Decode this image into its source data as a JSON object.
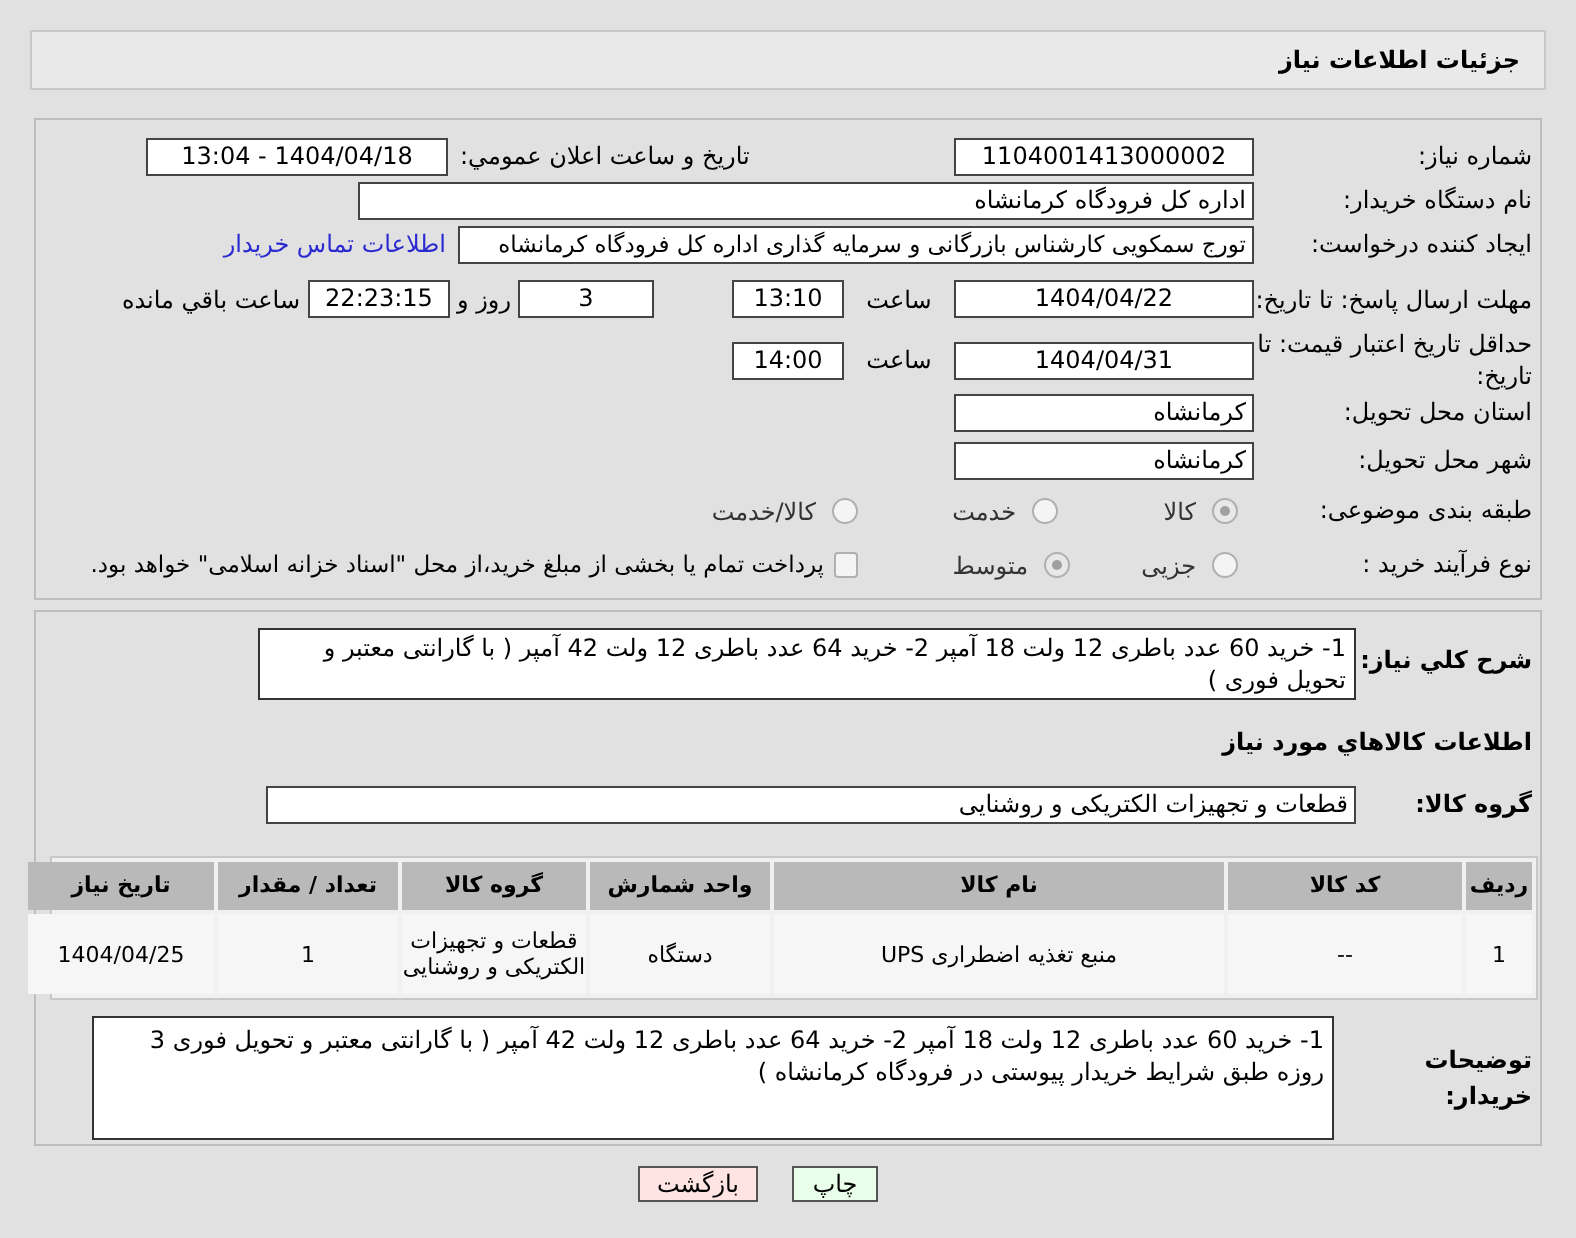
{
  "header": {
    "title": "جزئیات اطلاعات نیاز"
  },
  "need_number": {
    "label": "شماره نیاز:",
    "value": "1104001413000002"
  },
  "announce": {
    "label": "تاریخ و ساعت اعلان عمومي:",
    "value": "1404/04/18 - 13:04"
  },
  "buyer_org": {
    "label": "نام دستگاه خریدار:",
    "value": "اداره کل فرودگاه کرمانشاه"
  },
  "requester": {
    "label": "ایجاد کننده درخواست:",
    "value": "تورج سمکویی کارشناس بازرگانی و سرمایه گذاری اداره کل فرودگاه کرمانشاه",
    "link": "اطلاعات تماس خریدار"
  },
  "response_deadline": {
    "label": "مهلت ارسال پاسخ: تا تاریخ:",
    "date": "1404/04/22",
    "time_label": "ساعت",
    "time": "13:10",
    "days": "3",
    "days_label": "روز و",
    "remaining": "22:23:15",
    "remaining_label": "ساعت باقي مانده"
  },
  "price_validity": {
    "label": "حداقل تاریخ اعتبار قیمت: تا تاریخ:",
    "date": "1404/04/31",
    "time_label": "ساعت",
    "time": "14:00"
  },
  "province": {
    "label": "استان محل تحویل:",
    "value": "کرمانشاه"
  },
  "city": {
    "label": "شهر محل تحویل:",
    "value": "کرمانشاه"
  },
  "category": {
    "label": "طبقه بندی موضوعی:",
    "options": [
      {
        "label": "کالا",
        "selected": true
      },
      {
        "label": "خدمت",
        "selected": false
      },
      {
        "label": "کالا/خدمت",
        "selected": false
      }
    ]
  },
  "process": {
    "label": "نوع فرآیند خرید :",
    "options": [
      {
        "label": "جزیی",
        "selected": false
      },
      {
        "label": "متوسط",
        "selected": true
      }
    ],
    "payment": {
      "checked": false,
      "text": "پرداخت تمام یا بخشی از مبلغ خرید،از محل \"اسناد خزانه اسلامی\" خواهد بود."
    }
  },
  "description": {
    "label": "شرح کلي نیاز:",
    "value": "1- خرید 60 عدد باطری 12 ولت 18 آمپر  2- خرید 64 عدد باطری 12 ولت 42 آمپر  ( با گارانتی معتبر و تحویل فوری )"
  },
  "goods_title": "اطلاعات کالاهاي مورد نیاز",
  "group": {
    "label": "گروه کالا:",
    "value": "قطعات و تجهیزات الکتریکی و روشنایی"
  },
  "table": {
    "columns": [
      "ردیف",
      "کد کالا",
      "نام کالا",
      "واحد شمارش",
      "گروه کالا",
      "تعداد / مقدار",
      "تاریخ نیاز"
    ],
    "rows": [
      [
        "1",
        "--",
        "منبع تغذیه اضطراری UPS",
        "دستگاه",
        "قطعات و تجهیزات الکتریکی و روشنایی",
        "1",
        "1404/04/25"
      ]
    ]
  },
  "buyer_notes": {
    "label": "توضیحات خریدار:",
    "value": "1- خرید 60 عدد باطری 12 ولت 18 آمپر  2- خرید 64 عدد باطری 12 ولت 42 آمپر  ( با گارانتی معتبر و تحویل فوری 3 روزه طبق شرایط خریدار پیوستی در فرودگاه کرمانشاه )"
  },
  "buttons": [
    {
      "label": "چاپ",
      "kind": "print"
    },
    {
      "label": "بازگشت",
      "kind": "back"
    }
  ]
}
